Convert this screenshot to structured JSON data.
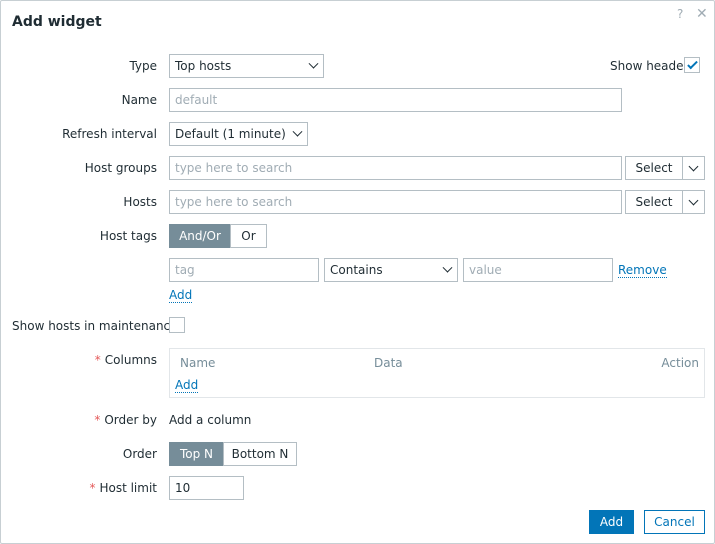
{
  "dialog": {
    "title": "Add widget",
    "help_icon": "?",
    "close_icon": "✕"
  },
  "form": {
    "type": {
      "label": "Type",
      "value": "Top hosts"
    },
    "show_header": {
      "label": "Show header",
      "checked": true
    },
    "name": {
      "label": "Name",
      "placeholder": "default"
    },
    "refresh_interval": {
      "label": "Refresh interval",
      "value": "Default (1 minute)"
    },
    "host_groups": {
      "label": "Host groups",
      "placeholder": "type here to search",
      "select_label": "Select"
    },
    "hosts": {
      "label": "Hosts",
      "placeholder": "type here to search",
      "select_label": "Select"
    },
    "host_tags": {
      "label": "Host tags",
      "options": [
        "And/Or",
        "Or"
      ],
      "selected": "And/Or",
      "row": {
        "tag_placeholder": "tag",
        "operator": "Contains",
        "value_placeholder": "value",
        "remove_label": "Remove"
      },
      "add_label": "Add"
    },
    "show_maintenance": {
      "label": "Show hosts in maintenance",
      "checked": false
    },
    "columns": {
      "label": "Columns",
      "headers": [
        "Name",
        "Data",
        "Action"
      ],
      "add_label": "Add"
    },
    "order_by": {
      "label": "Order by",
      "value": "Add a column"
    },
    "order": {
      "label": "Order",
      "options": [
        "Top N",
        "Bottom N"
      ],
      "selected": "Top N"
    },
    "host_limit": {
      "label": "Host limit",
      "value": "10"
    }
  },
  "footer": {
    "add_label": "Add",
    "cancel_label": "Cancel"
  },
  "colors": {
    "accent": "#0275b8",
    "segment_active": "#768d99",
    "required": "#e45959"
  }
}
